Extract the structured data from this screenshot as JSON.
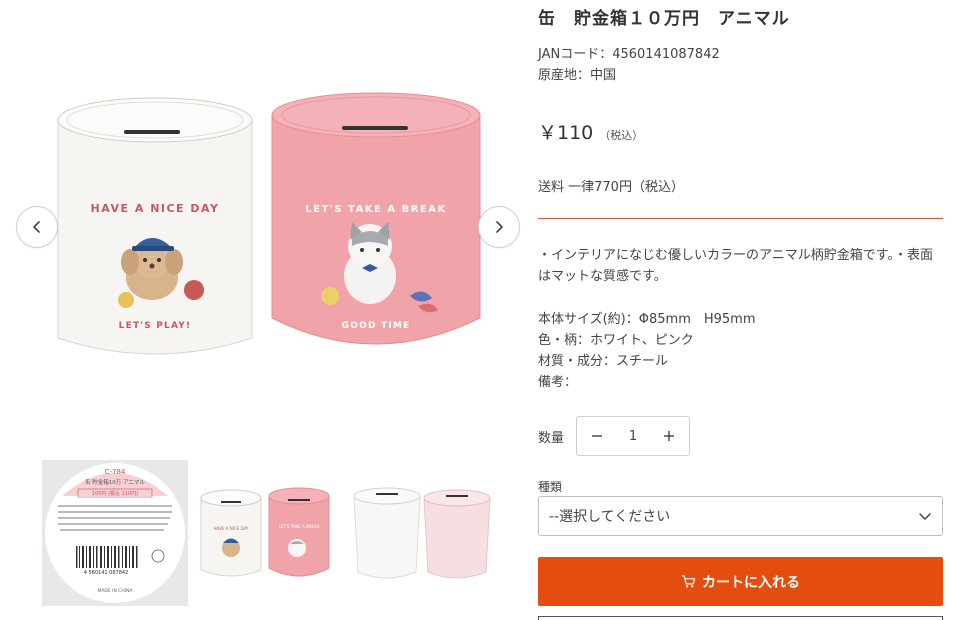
{
  "product": {
    "title": "缶　貯金箱１０万円　アニマル",
    "jan": "JANコード：4560141087842",
    "origin": "原産地：中国",
    "price": "￥110",
    "tax_note": "（税込）",
    "shipping": "送料 一律770円（税込）",
    "description": "・インテリアになじむ優しいカラーのアニマル柄貯金箱です。・表面はマットな質感です。",
    "specs": [
      "本体サイズ(約)：Φ85mm　H95mm",
      "色・柄：ホワイト、ピンク",
      "材質・成分：スチール",
      "備考："
    ]
  },
  "gallery": {
    "left_can": {
      "top_text": "HAVE A NICE DAY",
      "bottom_text": "LET'S PLAY!"
    },
    "right_can": {
      "top_text": "LET'S TAKE A BREAK",
      "bottom_text": "GOOD TIME"
    },
    "label_thumb": {
      "code": "C-784",
      "name": "缶 貯金箱10万 アニマル",
      "price": "100円 (税込 110円)",
      "barcode": "4 560141 087842",
      "made_in": "MADE IN CHINA"
    }
  },
  "quantity": {
    "label": "数量",
    "value": "1"
  },
  "variant": {
    "label": "種類",
    "placeholder": "--選択してください"
  },
  "cart": {
    "label": "カートに入れる"
  },
  "colors": {
    "accent": "#e34d0f",
    "divider": "#c9573a",
    "pink_can": "#f1a4ab",
    "white_can": "#f5f4f1"
  }
}
